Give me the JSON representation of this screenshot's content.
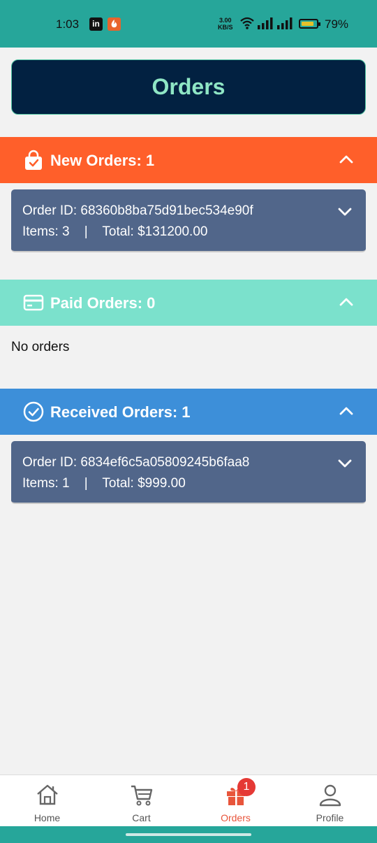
{
  "status_bar": {
    "time": "1:03",
    "linkedin_icon_text": "in",
    "net_speed_value": "3.00",
    "net_speed_unit": "KB/S",
    "battery_percent": "79%",
    "battery_level": 0.79
  },
  "header": {
    "title": "Orders"
  },
  "sections": [
    {
      "label": "New Orders: 1",
      "color": "#ff5f2a",
      "icon": "shopping-bag-check-icon",
      "orders": [
        {
          "id": "Order ID: 68360b8ba75d91bec534e90f",
          "meta": "Items: 3    |    Total: $131200.00"
        }
      ]
    },
    {
      "label": "Paid Orders: 0",
      "color": "#7be1cc",
      "icon": "credit-card-icon",
      "empty_text": "No orders"
    },
    {
      "label": "Received Orders: 1",
      "color": "#3d8fd9",
      "icon": "check-circle-icon",
      "orders": [
        {
          "id": "Order ID: 6834ef6c5a05809245b6faa8",
          "meta": "Items: 1    |    Total: $999.00"
        }
      ]
    }
  ],
  "bottom_nav": {
    "items": [
      {
        "label": "Home",
        "icon": "home-icon"
      },
      {
        "label": "Cart",
        "icon": "cart-icon"
      },
      {
        "label": "Orders",
        "icon": "gift-icon",
        "active": true
      },
      {
        "label": "Profile",
        "icon": "profile-icon"
      }
    ],
    "orders_badge": "1",
    "active_color": "#e8553b"
  }
}
